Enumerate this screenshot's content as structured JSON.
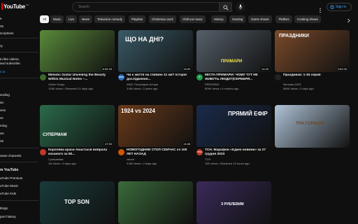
{
  "header": {
    "logo_text": "YouTube",
    "logo_region": "UA",
    "search_placeholder": "Search",
    "signin_label": "Sign in"
  },
  "sidebar": {
    "items": [
      {
        "label": "Home",
        "top": 0
      },
      {
        "label": "Shorts",
        "top": 0
      },
      {
        "label": "Subscriptions",
        "top": 0
      }
    ],
    "visible_texts": [
      "e",
      "rts",
      "scriptions",
      "ry",
      "to like videos,",
      "and subscribe.",
      "n in",
      "ending",
      "sic",
      "vies",
      "ve",
      "ming",
      "ws",
      "rts",
      "owse channels",
      "m YouTube",
      "uTube Premium",
      "uTube Music",
      "uTube Kids",
      "ttings",
      "port history"
    ],
    "history_heading": "ory",
    "more_heading": "m YouTube"
  },
  "chips": [
    "All",
    "Music",
    "Live",
    "News",
    "Television comedy",
    "Playlists",
    "Christmas carol",
    "Chill-out music",
    "History",
    "Gaming",
    "Game shows",
    "Thrillers",
    "Cooking shows"
  ],
  "videos": [
    {
      "title": "Melodic Guitar Unveiling the Beauty Within Musical Notes ~...",
      "channel": "Guitar Songs",
      "meta": "128K views • Streamed 11 days ago",
      "duration": "6:54:25",
      "thumb_text": "",
      "thumb_color": "#5a8a3a",
      "avatar_color": "#3a6a2a",
      "avatar_text": ""
    },
    {
      "title": "Чи є життя на глибині 11 км? Історія дослідження...",
      "channel": "WAS: Популярна Історія",
      "meta": "3.8M views • 2 years ago",
      "duration": "13:09",
      "thumb_text": "ЩО НА ДНІ?",
      "thumb_color": "#3a5a66",
      "avatar_color": "#2d6cbf",
      "avatar_text": "WAS"
    },
    {
      "title": "МІСТА-ПРИМАРИ: ЧОМУ ТУТ НЕ ЖИВУТЬ ЛЮДИ?|СЕРЕБРЯ...",
      "channel": "PRESSING",
      "meta": "809K views • 4 months ago",
      "duration": "14:40",
      "thumb_text": "ПРИМАРИ",
      "thumb_color": "#55606a",
      "avatar_color": "#1f9e4a",
      "avatar_text": "P"
    },
    {
      "title": "Праздники: 1-16 серия",
      "channel": "Фильмы 2023",
      "meta": "856K views • 3 days ago",
      "duration": "3:52:26",
      "thumb_text": "ПРАЗДНИКИ",
      "thumb_color": "#7a4a2a",
      "avatar_color": "#222222",
      "avatar_text": ""
    },
    {
      "title": "Королева краси Анастасія вибрала коханого за 50...",
      "channel": "Супермама",
      "meta": "1M views • 3 days ago",
      "duration": "47:53",
      "thumb_text": "СУПЕРМАМ",
      "thumb_color": "#2a6a4a",
      "avatar_color": "#c0392b",
      "avatar_text": ""
    },
    {
      "title": "НОВОГОДНИЙ СТОЛ СЕЙЧАС vs 100 ЛЕТ НАЗАД",
      "channel": "varcar",
      "meta": "3.8M views • 2 days ago",
      "duration": "13:48",
      "thumb_text": "1924 vs 2024",
      "thumb_color": "#6a3a1a",
      "avatar_color": "#d35400",
      "avatar_text": ""
    },
    {
      "title": "ТСН. Марафон «Єдині новини» за 27 грудня 2023",
      "channel": "ТСН",
      "meta": "19K views • Streamed 19 hours ago",
      "duration": "",
      "thumb_text": "ПРЯМИЙ ЕФІР",
      "thumb_color": "#1a2a4a",
      "avatar_color": "#c0392b",
      "avatar_text": "ТСН"
    },
    {
      "title": "",
      "channel": "",
      "meta": "",
      "duration": "",
      "thumb_text": "ТРИ ГОРІШКИ",
      "thumb_color": "#b0c4d8",
      "avatar_color": "#0f0f0f",
      "avatar_text": ""
    },
    {
      "title": "",
      "channel": "",
      "meta": "",
      "duration": "",
      "thumb_text": "TOP SON",
      "thumb_color": "#1a3a3a",
      "avatar_color": "#0f0f0f",
      "avatar_text": ""
    },
    {
      "title": "",
      "channel": "",
      "meta": "",
      "duration": "",
      "thumb_text": "",
      "thumb_color": "#3a6a3a",
      "avatar_color": "#0f0f0f",
      "avatar_text": ""
    },
    {
      "title": "",
      "channel": "",
      "meta": "",
      "duration": "",
      "thumb_text": "З РУБЛЕВИМ",
      "thumb_color": "#3a2a5a",
      "avatar_color": "#0f0f0f",
      "avatar_text": ""
    }
  ],
  "colors": {
    "background": "#0f0f0f",
    "accent_red": "#ff0000",
    "link_blue": "#3ea6ff",
    "chip_bg": "#272727"
  }
}
